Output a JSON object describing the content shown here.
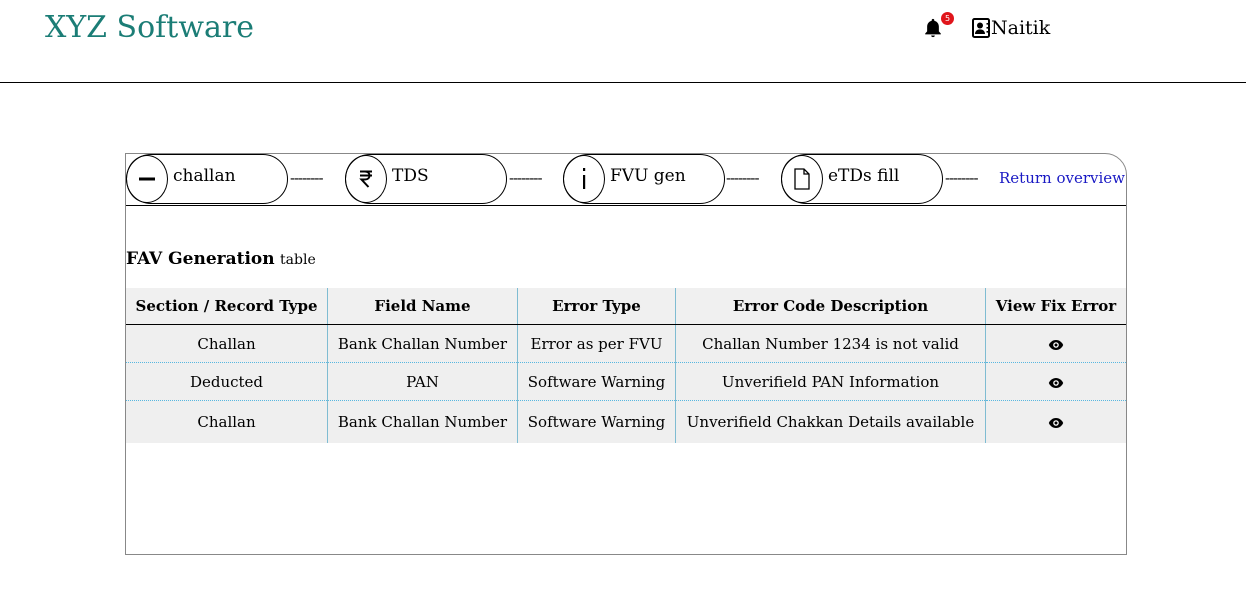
{
  "header": {
    "brand": "XYZ Software",
    "notification_count": "5",
    "user_name": "Naitik"
  },
  "steps": [
    {
      "label": "challan",
      "icon": "minus-icon"
    },
    {
      "label": "TDS",
      "icon": "rupee-icon"
    },
    {
      "label": "FVU gen",
      "icon": "info-icon"
    },
    {
      "label": "eTDs fill",
      "icon": "file-icon"
    }
  ],
  "connector": "--------",
  "return_link": "Return overview",
  "table": {
    "title_bold": "FAV Generation",
    "title_suffix": "table",
    "columns": [
      "Section / Record Type",
      "Field Name",
      "Error Type",
      "Error Code Description",
      "View Fix Error"
    ],
    "rows": [
      [
        "Challan",
        "Bank Challan Number",
        "Error as per FVU",
        "Challan Number 1234 is not valid"
      ],
      [
        "Deducted",
        "PAN",
        "Software Warning",
        "Unverifield PAN Information"
      ],
      [
        "Challan",
        "Bank Challan Number",
        "Software Warning",
        "Unverifield Chakkan Details available"
      ]
    ]
  },
  "colors": {
    "brand": "#1b7d76",
    "badge": "#e0151b",
    "link": "#1a1ac4",
    "row_background": "#efefef",
    "divider": "#58b7e0"
  }
}
